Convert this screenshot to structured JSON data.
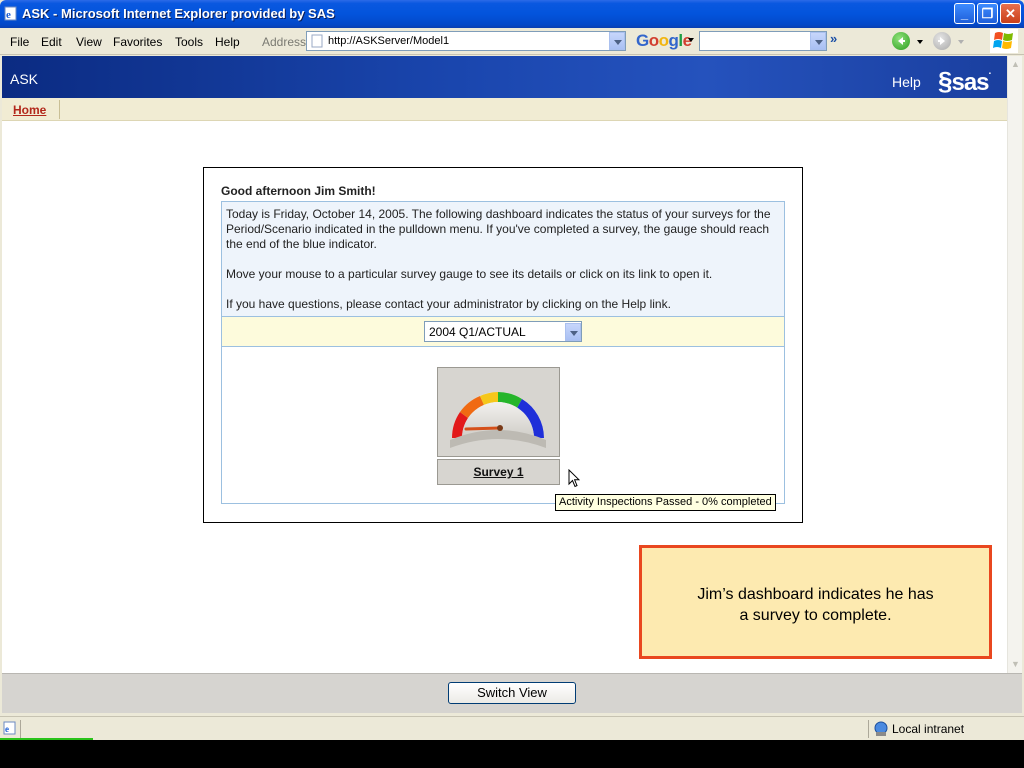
{
  "window": {
    "title": "ASK - Microsoft Internet Explorer provided by SAS"
  },
  "menu": {
    "file": "File",
    "edit": "Edit",
    "view": "View",
    "favorites": "Favorites",
    "tools": "Tools",
    "help": "Help"
  },
  "address": {
    "label": "Address",
    "url": "http://ASKServer/Model1"
  },
  "toolbar": {
    "google_label": "Google",
    "more_chevron": "»"
  },
  "app": {
    "name": "ASK",
    "help_link": "Help",
    "logo_text": "sas"
  },
  "nav": {
    "home_tab": "Home"
  },
  "dashboard": {
    "greeting": "Good afternoon Jim Smith!",
    "intro_line1": "Today is Friday, October 14, 2005. The following dashboard indicates the status of your surveys for the Period/Scenario indicated in the pulldown menu. If you've completed a survey, the gauge should reach the end of the blue indicator.",
    "intro_line2": "Move your mouse to a particular survey gauge to see its details or click on its link to open it.",
    "intro_line3": "If you have questions, please contact your administrator by clicking on the Help link.",
    "period_selected": "2004 Q1/ACTUAL",
    "survey_link": "Survey 1",
    "survey_completion_percent": 0,
    "tooltip": "Activity Inspections Passed - 0% completed"
  },
  "callout": {
    "line1": "Jim’s dashboard indicates he has",
    "line2": "a survey to complete."
  },
  "footer": {
    "switch_view": "Switch View"
  },
  "statusbar": {
    "zone": "Local intranet"
  },
  "colors": {
    "titlebar": "#0354dc",
    "sas_header": "#1a46ae",
    "callout_border": "#e9471f",
    "callout_fill": "#fdeab0",
    "home_link": "#b2271a"
  }
}
